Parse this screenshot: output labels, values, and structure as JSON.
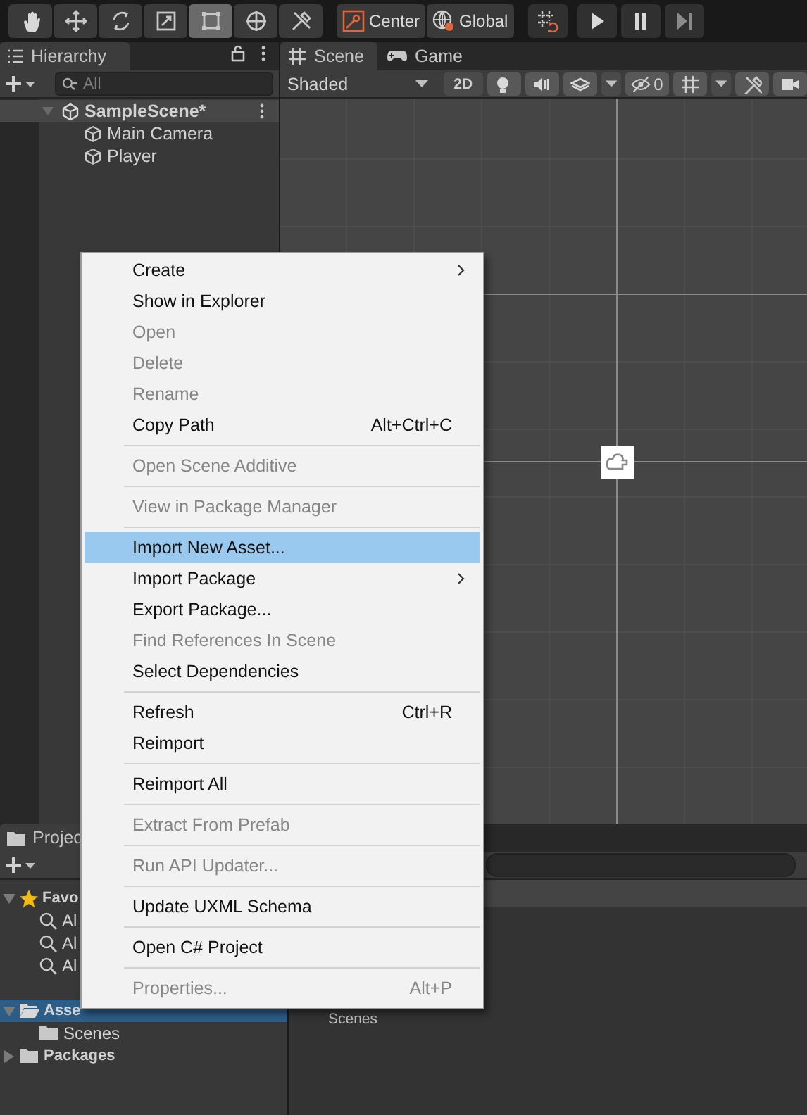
{
  "toolbar": {
    "tools": [
      {
        "selected": false
      },
      {
        "selected": false
      },
      {
        "selected": false
      },
      {
        "selected": false
      },
      {
        "selected": true
      },
      {
        "selected": false
      },
      {
        "selected": false
      }
    ],
    "pivot": [
      {
        "label": "Center"
      },
      {
        "label": "Global"
      }
    ],
    "playback": [
      {
        "kind": "snap"
      },
      {
        "kind": "play"
      },
      {
        "kind": "pause"
      },
      {
        "kind": "step"
      }
    ]
  },
  "hierarchy": {
    "tab": "Hierarchy",
    "search": {
      "placeholder": "All"
    },
    "items": [
      {
        "label": "SampleScene*",
        "kind": "scene",
        "expanded": true,
        "children": [
          {
            "label": "Main Camera",
            "kind": "object"
          },
          {
            "label": "Player",
            "kind": "object"
          }
        ]
      }
    ]
  },
  "scene": {
    "tabs": [
      {
        "label": "Scene",
        "selected": true
      },
      {
        "label": "Game",
        "selected": false
      }
    ],
    "shading": "Shaded",
    "mode_2d": "2D",
    "hidden_count": "0"
  },
  "project": {
    "tab": "Projec",
    "tree": [
      {
        "label": "Favo",
        "kind": "favorites",
        "expanded": true,
        "selected": false,
        "children": [
          {
            "label": "Al",
            "kind": "search",
            "selected": false
          },
          {
            "label": "Al",
            "kind": "search",
            "selected": false
          },
          {
            "label": "Al",
            "kind": "search",
            "selected": false
          }
        ]
      },
      {
        "label": "Asse",
        "kind": "folder",
        "expanded": true,
        "selected": true,
        "children": [
          {
            "label": "Scenes",
            "kind": "folder",
            "selected": false
          }
        ]
      },
      {
        "label": "Packages",
        "kind": "folder",
        "expanded": false,
        "selected": false
      }
    ],
    "content": [
      {
        "label": "Scenes"
      }
    ]
  },
  "context_menu": [
    {
      "kind": "item",
      "label": "Create",
      "disabled": false,
      "submenu": true,
      "selected": false
    },
    {
      "kind": "item",
      "label": "Show in Explorer",
      "disabled": false,
      "submenu": false,
      "selected": false
    },
    {
      "kind": "item",
      "label": "Open",
      "disabled": true,
      "submenu": false,
      "selected": false
    },
    {
      "kind": "item",
      "label": "Delete",
      "disabled": true,
      "submenu": false,
      "selected": false
    },
    {
      "kind": "item",
      "label": "Rename",
      "disabled": true,
      "submenu": false,
      "selected": false
    },
    {
      "kind": "item",
      "label": "Copy Path",
      "shortcut": "Alt+Ctrl+C",
      "disabled": false,
      "submenu": false,
      "selected": false
    },
    {
      "kind": "separator"
    },
    {
      "kind": "item",
      "label": "Open Scene Additive",
      "disabled": true,
      "submenu": false,
      "selected": false
    },
    {
      "kind": "separator"
    },
    {
      "kind": "item",
      "label": "View in Package Manager",
      "disabled": true,
      "submenu": false,
      "selected": false
    },
    {
      "kind": "separator"
    },
    {
      "kind": "item",
      "label": "Import New Asset...",
      "disabled": false,
      "submenu": false,
      "selected": true
    },
    {
      "kind": "item",
      "label": "Import Package",
      "disabled": false,
      "submenu": true,
      "selected": false
    },
    {
      "kind": "item",
      "label": "Export Package...",
      "disabled": false,
      "submenu": false,
      "selected": false
    },
    {
      "kind": "item",
      "label": "Find References In Scene",
      "disabled": true,
      "submenu": false,
      "selected": false
    },
    {
      "kind": "item",
      "label": "Select Dependencies",
      "disabled": false,
      "submenu": false,
      "selected": false
    },
    {
      "kind": "separator"
    },
    {
      "kind": "item",
      "label": "Refresh",
      "shortcut": "Ctrl+R",
      "disabled": false,
      "submenu": false,
      "selected": false
    },
    {
      "kind": "item",
      "label": "Reimport",
      "disabled": false,
      "submenu": false,
      "selected": false
    },
    {
      "kind": "separator"
    },
    {
      "kind": "item",
      "label": "Reimport All",
      "disabled": false,
      "submenu": false,
      "selected": false
    },
    {
      "kind": "separator"
    },
    {
      "kind": "item",
      "label": "Extract From Prefab",
      "disabled": true,
      "submenu": false,
      "selected": false
    },
    {
      "kind": "separator"
    },
    {
      "kind": "item",
      "label": "Run API Updater...",
      "disabled": true,
      "submenu": false,
      "selected": false
    },
    {
      "kind": "separator"
    },
    {
      "kind": "item",
      "label": "Update UXML Schema",
      "disabled": false,
      "submenu": false,
      "selected": false
    },
    {
      "kind": "separator"
    },
    {
      "kind": "item",
      "label": "Open C# Project",
      "disabled": false,
      "submenu": false,
      "selected": false
    },
    {
      "kind": "separator"
    },
    {
      "kind": "item",
      "label": "Properties...",
      "shortcut": "Alt+P",
      "disabled": true,
      "submenu": false,
      "selected": false
    }
  ]
}
